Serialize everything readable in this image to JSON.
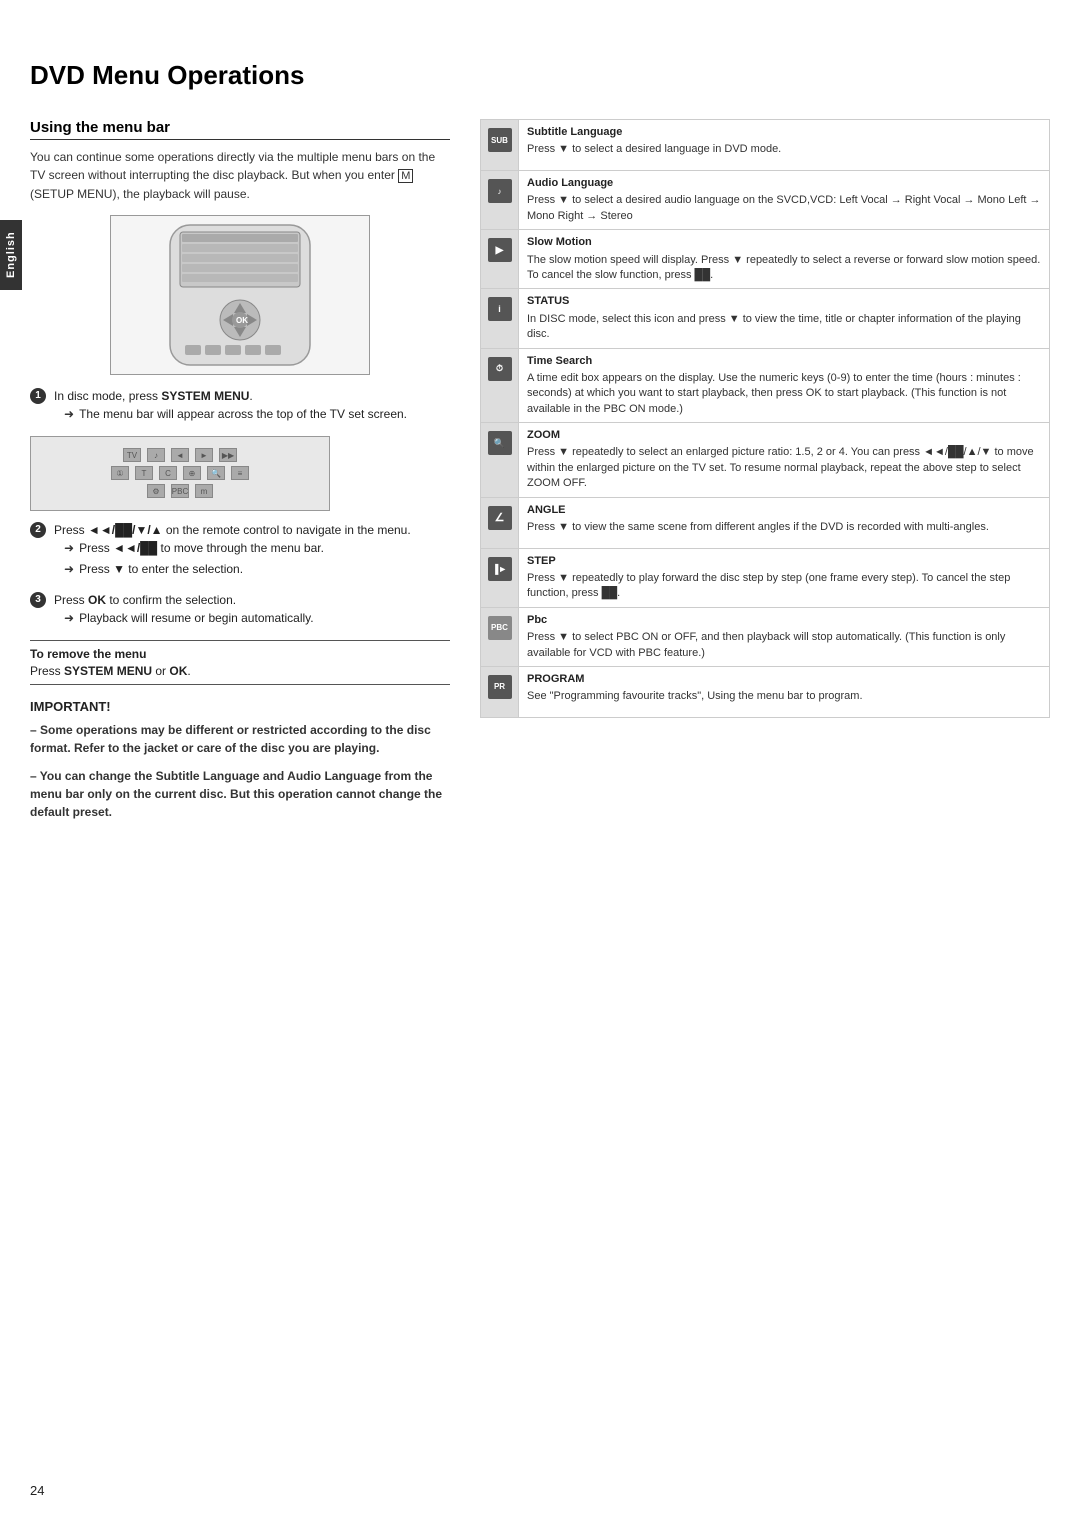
{
  "page": {
    "title": "DVD Menu Operations",
    "page_number": "24",
    "english_label": "English"
  },
  "left_section": {
    "heading": "Using the menu bar",
    "intro": "You can continue some operations directly via the multiple menu bars on the TV screen without interrupting the disc playback. But when you enter",
    "setup_menu": "SETUP MENU",
    "intro2": ", the playback will pause.",
    "steps": [
      {
        "num": "1",
        "text": "In disc mode, press",
        "bold": "SYSTEM MENU",
        "text2": ".",
        "arrows": [
          "The menu bar will appear across the top of the TV set screen."
        ]
      },
      {
        "num": "2",
        "text": "Press ◄◄/██/▼/▲ on the remote control to navigate in the menu.",
        "arrows": [
          "Press ◄◄/██ to move through the menu bar.",
          "Press ▼ to enter the selection."
        ]
      },
      {
        "num": "3",
        "text": "Press",
        "bold": "OK",
        "text2": "to confirm the selection.",
        "arrows": [
          "Playback will resume or begin automatically."
        ]
      }
    ],
    "remove_menu": {
      "label": "To remove the menu",
      "text": "Press",
      "bold1": "SYSTEM MENU",
      "text2": "or",
      "bold2": "OK",
      "text3": "."
    },
    "important": {
      "title": "IMPORTANT!",
      "items": [
        "– Some operations may be different or restricted according to the disc format. Refer to the jacket or care of the disc you are playing.",
        "– You can change the Subtitle Language and Audio Language from the menu bar only on the current disc. But this operation cannot change the default preset."
      ]
    }
  },
  "right_section": {
    "features": [
      {
        "icon_label": "SUB",
        "icon_type": "subtitle",
        "title": "Subtitle Language",
        "description": "Press ▼ to select a desired language in DVD mode."
      },
      {
        "icon_label": "AUD",
        "icon_type": "audio",
        "title": "Audio Language",
        "description": "Press ▼ to select a desired audio language on the SVCD,VCD: Left Vocal → Right Vocal → Mono Left → Mono Right → Stereo"
      },
      {
        "icon_label": "►",
        "icon_type": "slow",
        "title": "Slow Motion",
        "description": "The slow motion speed will display. Press ▼ repeatedly to select a reverse or forward slow motion speed. To cancel the slow function, press ██."
      },
      {
        "icon_label": "i",
        "icon_type": "status",
        "title": "STATUS",
        "description": "In DISC mode, select this icon and press ▼ to view the time, title or chapter information of the playing disc."
      },
      {
        "icon_label": "⏱",
        "icon_type": "time",
        "title": "Time Search",
        "description": "A time edit box appears on the display. Use the numeric keys (0-9) to enter the time (hours : minutes : seconds) at which you want to start playback, then press OK to start playback. (This function is not available in the PBC ON mode.)"
      },
      {
        "icon_label": "🔍",
        "icon_type": "zoom",
        "title": "ZOOM",
        "description": "Press ▼ repeatedly to select an enlarged picture ratio: 1.5, 2 or 4. You can press ◄◄/██/▲/▼ to move within the enlarged picture on the TV set. To resume normal playback, repeat the above step to select ZOOM OFF."
      },
      {
        "icon_label": "∠",
        "icon_type": "angle",
        "title": "ANGLE",
        "description": "Press ▼ to view the same scene from different angles if the DVD is recorded with multi-angles."
      },
      {
        "icon_label": "▐►",
        "icon_type": "step",
        "title": "STEP",
        "description": "Press ▼ repeatedly to play forward the disc step by step (one frame every step). To cancel the step function, press ██."
      },
      {
        "icon_label": "PBC",
        "icon_type": "pbc",
        "title": "Pbc",
        "description": "Press ▼ to select PBC ON or OFF, and then playback will stop automatically. (This function is only available for VCD with PBC feature.)"
      },
      {
        "icon_label": "PR",
        "icon_type": "program",
        "title": "PROGRAM",
        "description": "See \"Programming favourite tracks\", Using the menu bar to program."
      }
    ]
  }
}
